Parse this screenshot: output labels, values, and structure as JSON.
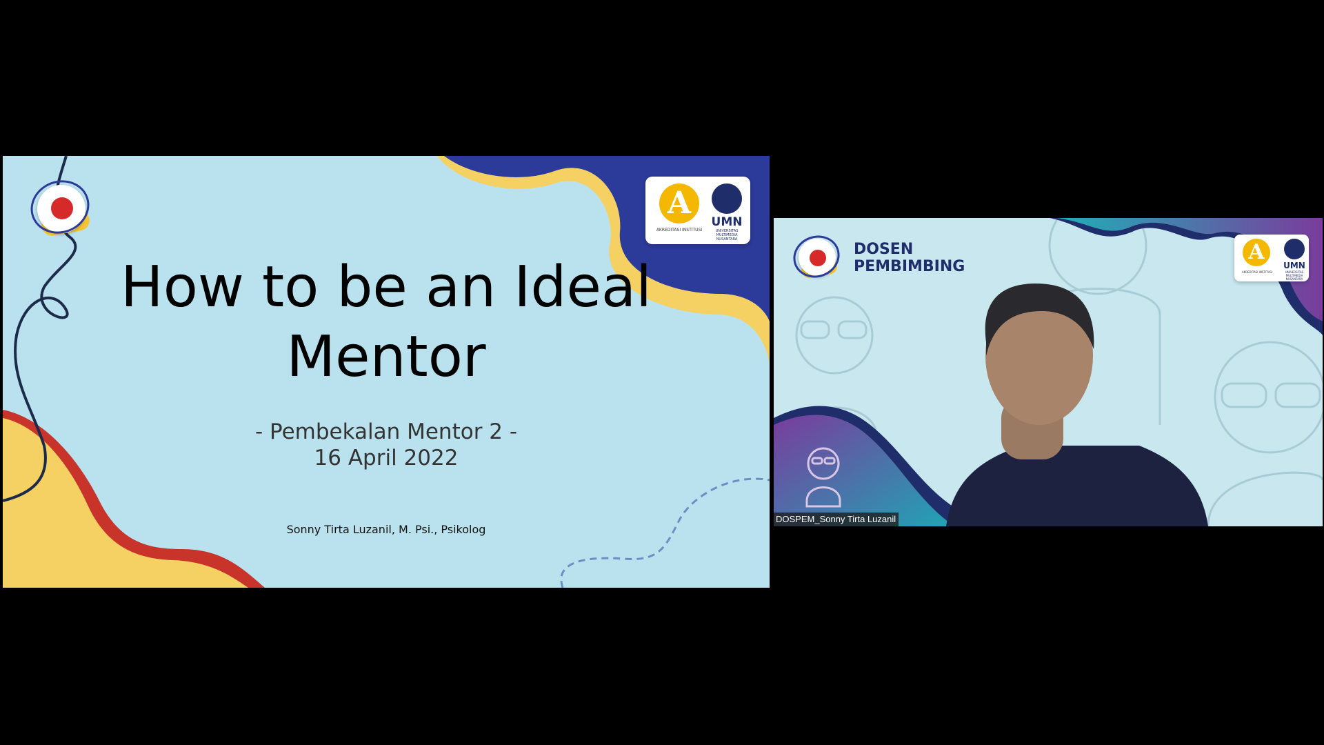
{
  "slide": {
    "title_line1": "How to be an Ideal",
    "title_line2": "Mentor",
    "subtitle": "- Pembekalan Mentor 2 -",
    "date": "16 April 2022",
    "presenter": "Sonny Tirta Luzanil, M. Psi., Psikolog",
    "accreditation_letter": "A",
    "accreditation_label": "AKREDITASI INSTITUSI",
    "university_short": "UMN",
    "university_full": "UNIVERSITAS MULTIMEDIA NUSANTARA"
  },
  "video": {
    "background_title_line1": "DOSEN",
    "background_title_line2": "PEMBIMBING",
    "participant_name": "DOSPEM_Sonny Tirta Luzanil",
    "accreditation_letter": "A",
    "accreditation_label": "AKREDITASI INSTITUSI",
    "university_short": "UMN",
    "university_full": "UNIVERSITAS MULTIMEDIA NUSANTARA"
  },
  "colors": {
    "slide_bg": "#b9e2ee",
    "navy": "#2c3a99",
    "yellow": "#f5d063",
    "red": "#c8332a",
    "purple": "#7a3c9c",
    "teal": "#1fa5b5"
  }
}
